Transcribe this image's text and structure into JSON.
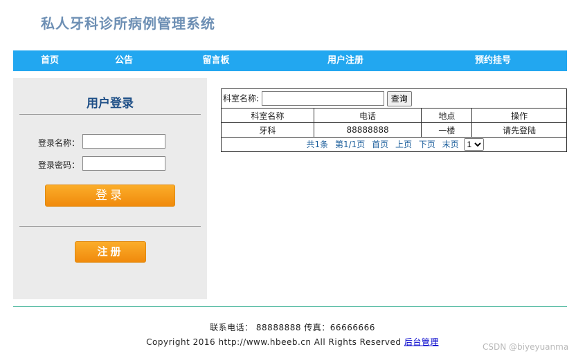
{
  "header": {
    "title": "私人牙科诊所病例管理系统"
  },
  "nav": {
    "items": [
      {
        "label": "首页"
      },
      {
        "label": "公告"
      },
      {
        "label": "留言板"
      },
      {
        "label": "用户注册"
      },
      {
        "label": "预约挂号"
      }
    ]
  },
  "login": {
    "title": "用户登录",
    "username_label": "登录名称：",
    "password_label": "登录密码：",
    "username_value": "",
    "password_value": "",
    "login_button": "登录",
    "register_button": "注册"
  },
  "dept": {
    "search_label": "科室名称:",
    "search_value": "",
    "search_button": "查询",
    "columns": [
      "科室名称",
      "电话",
      "地点",
      "操作"
    ],
    "rows": [
      {
        "name": "牙科",
        "phone": "88888888",
        "location": "一楼",
        "action": "请先登陆"
      }
    ],
    "pager": {
      "total": "共1条",
      "page_info": "第1/1页",
      "first": "首页",
      "prev": "上页",
      "next": "下页",
      "last": "末页",
      "selected_page": "1"
    }
  },
  "footer": {
    "contact": "联系电话： 88888888 传真：66666666",
    "copyright": "Copyright 2016 http://www.hbeeb.cn All Rights Reserved",
    "admin_link": "后台管理"
  },
  "watermark": "CSDN @biyeyuanma",
  "colors": {
    "nav_bg": "#22a7f0",
    "title": "#6d8fb4",
    "login_title": "#1d4e86",
    "button": "#f59a17",
    "panel_bg": "#ebebeb"
  }
}
